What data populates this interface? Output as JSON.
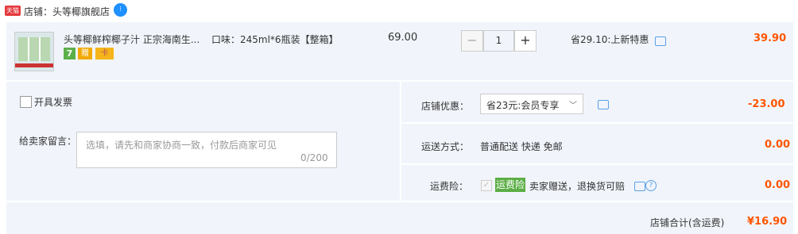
{
  "shop": {
    "badge": "天猫",
    "label": "店铺：",
    "name": "头等椰旗舰店"
  },
  "item": {
    "title": "头等椰鲜榨椰子汁 正宗海南生...",
    "tags": [
      "7",
      "赠",
      "卡"
    ],
    "sku": "口味：245ml*6瓶装【整箱】",
    "unit_price": "69.00",
    "quantity": "1",
    "minus": "−",
    "plus": "+",
    "promo": "省29.10:上新特惠",
    "total": "39.90"
  },
  "invoice": {
    "label": "开具发票"
  },
  "remark": {
    "label": "给卖家留言：",
    "placeholder": "选填，请先和商家协商一致，付款后商家可见",
    "count": "0/200"
  },
  "discount": {
    "label": "店铺优惠：",
    "selected": "省23元:会员专享",
    "value": "-23.00"
  },
  "shipping": {
    "label": "运送方式：",
    "method": "普通配送 快递 免邮",
    "fee": "0.00"
  },
  "insurance": {
    "label": "运费险：",
    "badge": "运费险",
    "text": "卖家赠送，退换货可赔",
    "fee": "0.00"
  },
  "summary": {
    "label": "店铺合计(含运费)",
    "value": "¥16.90"
  },
  "colors": {
    "accent": "#ff5500",
    "panel_bg": "#f1f5fb",
    "tmall_red": "#e4393c",
    "insurance_green": "#5bae45"
  }
}
